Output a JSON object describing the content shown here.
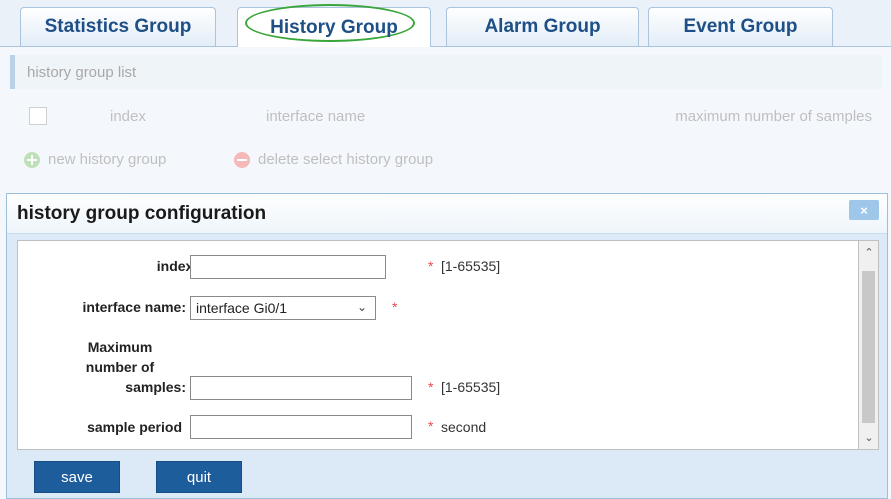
{
  "tabs": [
    {
      "label": "Statistics Group"
    },
    {
      "label": "History Group"
    },
    {
      "label": "Alarm Group"
    },
    {
      "label": "Event Group"
    }
  ],
  "list": {
    "title": "history group list",
    "columns": [
      "index",
      "interface name",
      "maximum number of samples"
    ],
    "new_label": "new history group",
    "delete_label": "delete select history group"
  },
  "dialog": {
    "title": "history group configuration",
    "close_glyph": "×",
    "fields": {
      "index": {
        "label": "index:",
        "value": "",
        "hint": "[1-65535]"
      },
      "interface": {
        "label": "interface name:",
        "value": "interface Gi0/1"
      },
      "max_samples": {
        "label_line1": "Maximum",
        "label_line2": "number of",
        "label_line3": "samples:",
        "value": "",
        "hint": "[1-65535]"
      },
      "sample_period": {
        "label": "sample period",
        "value": "",
        "hint": "second"
      }
    },
    "required_mark": "*",
    "save_label": "save",
    "quit_label": "quit"
  },
  "colors": {
    "accent": "#1d5d9c",
    "tab_text": "#1e4f86",
    "highlight_ring": "#3aa63a",
    "required": "#e84a4a"
  }
}
